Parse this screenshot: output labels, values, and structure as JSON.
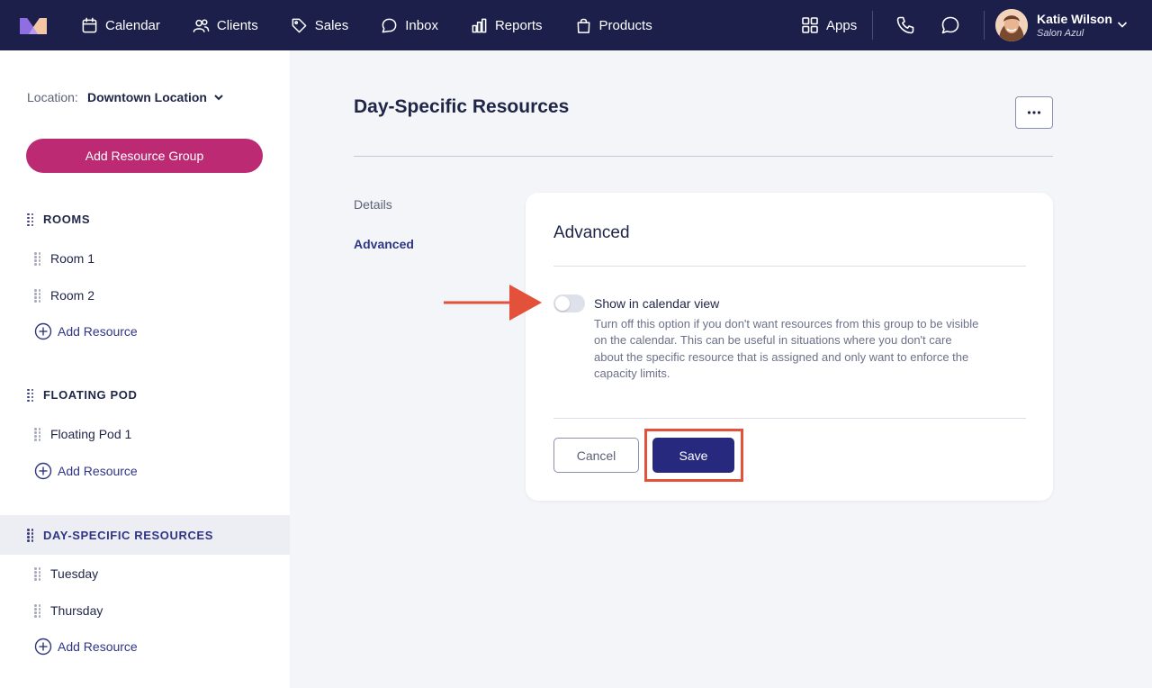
{
  "topbar": {
    "logo_icon": "brand-logo-icon",
    "nav": [
      {
        "label": "Calendar",
        "icon": "calendar-icon"
      },
      {
        "label": "Clients",
        "icon": "users-icon"
      },
      {
        "label": "Sales",
        "icon": "tag-icon"
      },
      {
        "label": "Inbox",
        "icon": "chat-icon"
      },
      {
        "label": "Reports",
        "icon": "bar-chart-icon"
      },
      {
        "label": "Products",
        "icon": "shopping-bag-icon"
      }
    ],
    "apps_label": "Apps",
    "user": {
      "name": "Katie Wilson",
      "subtitle": "Salon Azul"
    }
  },
  "sidebar": {
    "location_label": "Location:",
    "location_value": "Downtown Location",
    "add_group_label": "Add Resource Group",
    "add_resource_label": "Add Resource",
    "groups": [
      {
        "name": "ROOMS",
        "items": [
          "Room 1",
          "Room 2"
        ]
      },
      {
        "name": "FLOATING POD",
        "items": [
          "Floating Pod 1"
        ]
      },
      {
        "name": "DAY-SPECIFIC RESOURCES",
        "items": [
          "Tuesday",
          "Thursday"
        ],
        "active": true
      }
    ]
  },
  "main": {
    "title": "Day-Specific Resources",
    "tabs": [
      {
        "label": "Details",
        "active": false
      },
      {
        "label": "Advanced",
        "active": true
      }
    ],
    "card": {
      "title": "Advanced",
      "toggle_label": "Show in calendar view",
      "toggle_on": false,
      "toggle_description": "Turn off this option if you don't want resources from this group to be visible on the calendar. This can be useful in situations where you don't care about the specific resource that is assigned and only want to enforce the capacity limits.",
      "cancel_label": "Cancel",
      "save_label": "Save"
    }
  },
  "colors": {
    "nav_bg": "#1c1f4a",
    "accent_pink": "#bb2a72",
    "primary_navy": "#26297d",
    "annotation_red": "#e3513b"
  }
}
